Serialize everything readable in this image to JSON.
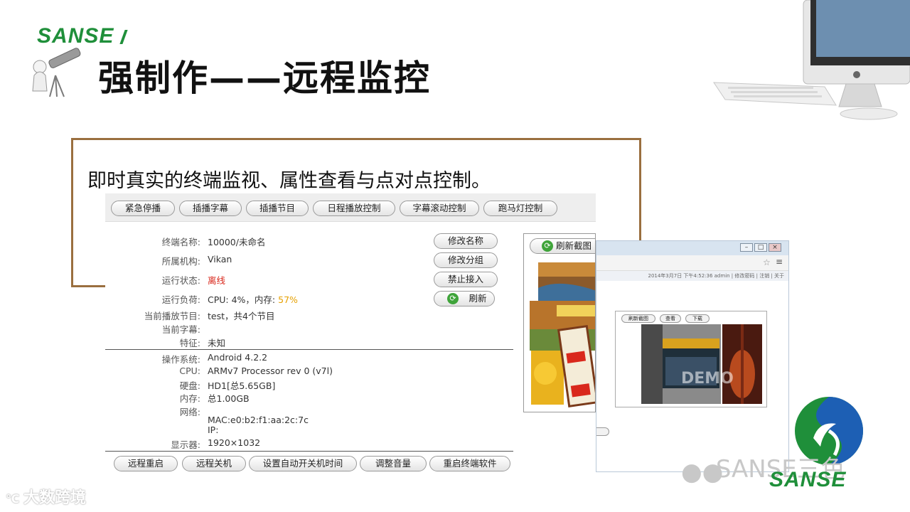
{
  "brand": {
    "name": "SANSE"
  },
  "page_title": "强制作——远程监控",
  "subtitle": "即时真实的终端监视、属性查看与点对点控制。",
  "toolbar": {
    "buttons": [
      "紧急停播",
      "插播字幕",
      "插播节目",
      "日程播放控制",
      "字幕滚动控制",
      "跑马灯控制"
    ]
  },
  "terminal": {
    "rows": [
      {
        "label": "终端名称:",
        "value": "10000/未命名"
      },
      {
        "label": "所属机构:",
        "value": "Vikan"
      },
      {
        "label": "运行状态:",
        "value": "离线"
      },
      {
        "label": "运行负荷:",
        "value": "CPU: 4%，内存: ",
        "highlight": "57%"
      },
      {
        "label": "当前播放节目:",
        "value": "test，共4个节目"
      },
      {
        "label": "当前字幕:",
        "value": ""
      },
      {
        "label": "特征:",
        "value": "未知"
      }
    ],
    "side_buttons": [
      "修改名称",
      "修改分组",
      "禁止接入",
      "刷新"
    ]
  },
  "system": {
    "rows": [
      {
        "label": "操作系统:",
        "value": "Android 4.2.2"
      },
      {
        "label": "CPU:",
        "value": "ARMv7 Processor rev 0 (v7l)"
      },
      {
        "label": "硬盘:",
        "value": "HD1[总5.65GB]"
      },
      {
        "label": "内存:",
        "value": "总1.00GB"
      },
      {
        "label": "网络:",
        "value": ""
      },
      {
        "label": "",
        "value": "MAC:e0:b2:f1:aa:2c:7c"
      },
      {
        "label": "",
        "value": "IP:"
      },
      {
        "label": "显示器:",
        "value": "1920×1032"
      }
    ]
  },
  "bottom_buttons": [
    "远程重启",
    "远程关机",
    "设置自动开关机时间",
    "调整音量",
    "重启终端软件"
  ],
  "screenshot": {
    "refresh_label": "刷新截图"
  },
  "browser": {
    "status": "2014年3月7日 下午4:52:36  admin | 修改密码 | 注销 | 关于",
    "inner_buttons": [
      "刷新截图",
      "查看",
      "下载"
    ],
    "demo": "DEMO"
  },
  "watermarks": {
    "wechat": "SANSE三色",
    "corner": "大数跨境"
  },
  "colors": {
    "brand_green": "#1f8f3a",
    "frame_brown": "#9a6f3f",
    "offline_red": "#d9281c",
    "memory_orange": "#e6a000"
  }
}
